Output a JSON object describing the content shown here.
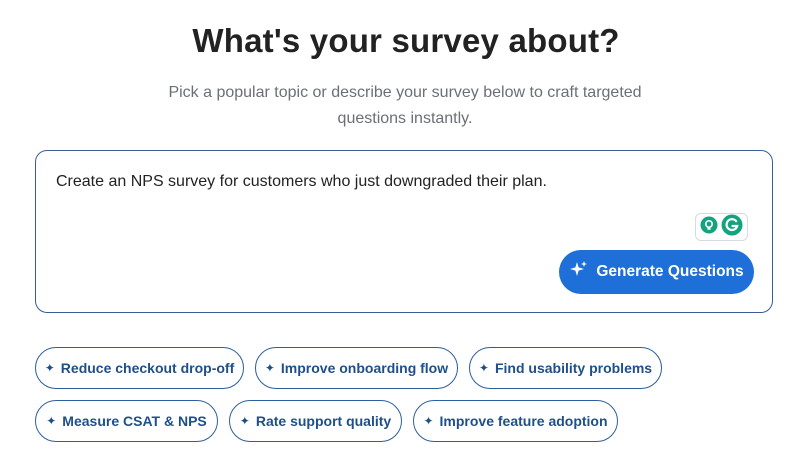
{
  "header": {
    "title": "What's your survey about?",
    "subtitle": "Pick a popular topic or describe your survey below to craft targeted questions instantly."
  },
  "prompt": {
    "value": "Create an NPS survey for customers who just downgraded their plan."
  },
  "generate_button": {
    "label": "Generate Questions",
    "icon": "sparkle-icon"
  },
  "chips": [
    {
      "label": "Reduce checkout drop-off",
      "icon": "sparkle-icon"
    },
    {
      "label": "Improve onboarding flow",
      "icon": "sparkle-icon"
    },
    {
      "label": "Find usability problems",
      "icon": "sparkle-icon"
    },
    {
      "label": "Measure CSAT & NPS",
      "icon": "sparkle-icon"
    },
    {
      "label": "Rate support quality",
      "icon": "sparkle-icon"
    },
    {
      "label": "Improve feature adoption",
      "icon": "sparkle-icon"
    }
  ],
  "colors": {
    "accent": "#1f6fd8",
    "chip_border": "#2c5f9e",
    "chip_text": "#1f4f8a",
    "box_border": "#3d5a98",
    "assistant_green": "#14a37f"
  }
}
